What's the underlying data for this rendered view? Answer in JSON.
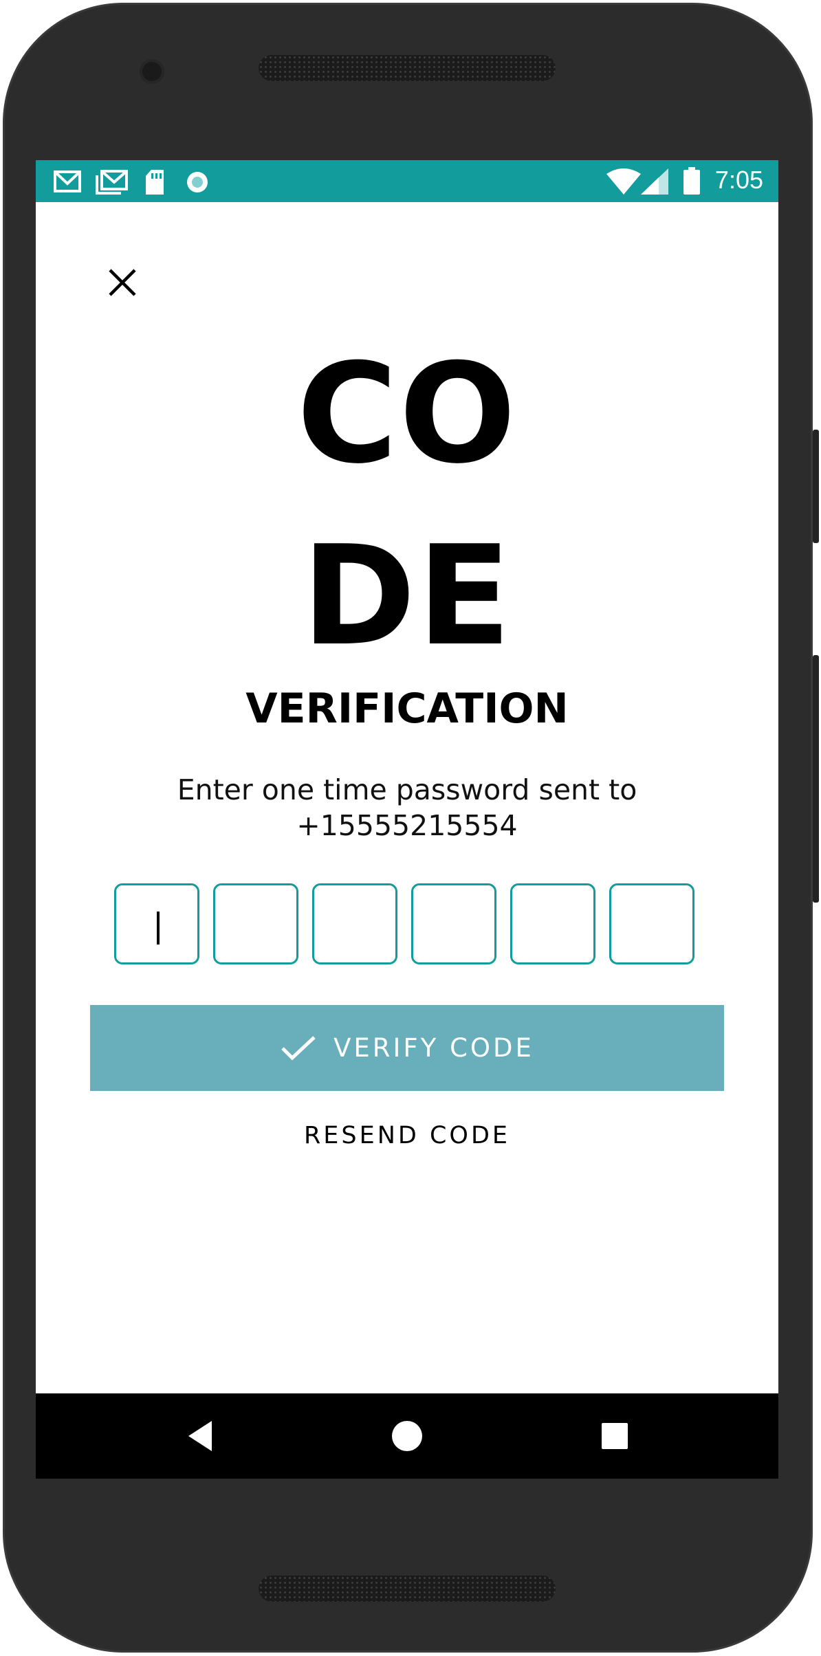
{
  "status_bar": {
    "time": "7:05",
    "left_icons": [
      "gmail-icon",
      "gmail-stacked-icon",
      "sd-card-icon",
      "sync-icon"
    ],
    "right_icons": [
      "wifi-icon",
      "signal-icon",
      "battery-icon"
    ],
    "color": "#129c9b"
  },
  "header": {
    "close_icon": "close-icon",
    "title_line1": "CO",
    "title_line2": "DE",
    "title_line3": "VERIFICATION"
  },
  "instructions": {
    "line1": "Enter one time password sent to",
    "phone": "+15555215554"
  },
  "otp": {
    "length": 6,
    "values": [
      "",
      "",
      "",
      "",
      "",
      ""
    ],
    "focused_index": 0,
    "border_color": "#129c9b"
  },
  "actions": {
    "verify_label": "VERIFY CODE",
    "verify_icon": "check-icon",
    "verify_color": "#68afbb",
    "resend_label": "RESEND CODE"
  },
  "nav_bar": {
    "back_icon": "back-triangle-icon",
    "home_icon": "home-circle-icon",
    "recents_icon": "recents-square-icon"
  }
}
